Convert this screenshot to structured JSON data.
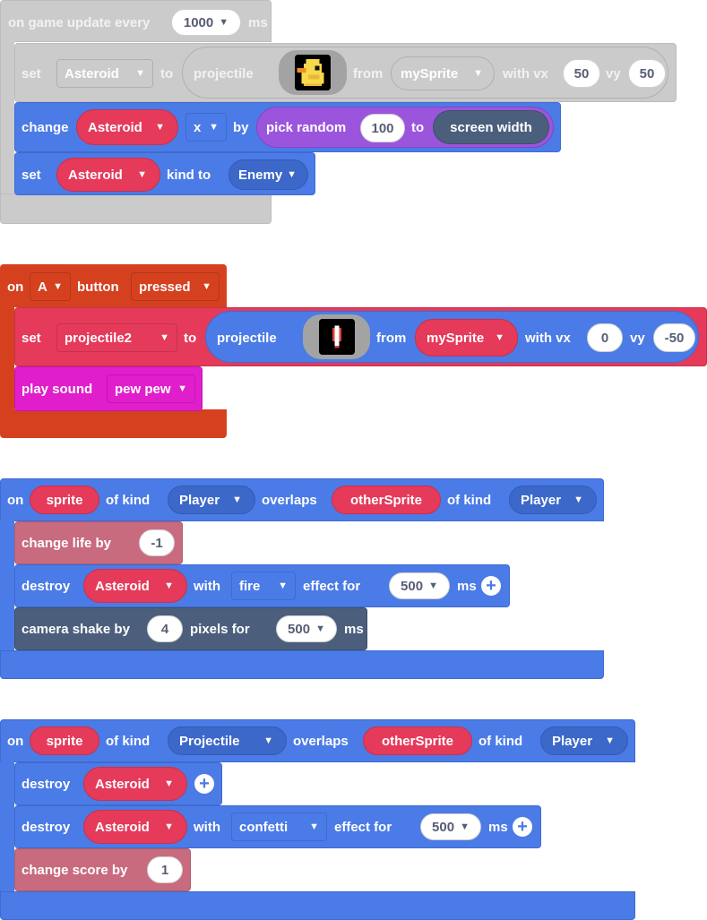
{
  "event_update": {
    "header": {
      "prefix": "on game update every",
      "interval": "1000",
      "suffix": "ms"
    },
    "set_row": {
      "set": "set",
      "variable": "Asteroid",
      "to": "to",
      "projectile": "projectile",
      "from": "from",
      "source": "mySprite",
      "with_vx": "with vx",
      "vx": "50",
      "vy_label": "vy",
      "vy": "50"
    },
    "change_row": {
      "change": "change",
      "variable": "Asteroid",
      "prop": "x",
      "by": "by",
      "pick_random": "pick random",
      "min": "100",
      "to": "to",
      "max": "screen width"
    },
    "kind_row": {
      "set": "set",
      "variable": "Asteroid",
      "kind_to": "kind to",
      "kind": "Enemy"
    }
  },
  "event_button": {
    "header": {
      "on": "on",
      "button": "A",
      "button_label": "button",
      "action": "pressed"
    },
    "set_row": {
      "set": "set",
      "variable": "projectile2",
      "to": "to",
      "projectile": "projectile",
      "from": "from",
      "source": "mySprite",
      "with_vx": "with vx",
      "vx": "0",
      "vy_label": "vy",
      "vy": "-50"
    },
    "sound_row": {
      "play": "play sound",
      "sound": "pew pew"
    }
  },
  "event_overlap1": {
    "header": {
      "on": "on",
      "sprite": "sprite",
      "of_kind": "of kind",
      "kind1": "Player",
      "overlaps": "overlaps",
      "other": "otherSprite",
      "of_kind2": "of kind",
      "kind2": "Player"
    },
    "life_row": {
      "label": "change life by",
      "value": "-1"
    },
    "destroy_row": {
      "destroy": "destroy",
      "variable": "Asteroid",
      "with": "with",
      "effect": "fire",
      "effect_for": "effect for",
      "duration": "500",
      "ms": "ms"
    },
    "shake_row": {
      "label": "camera shake by",
      "pixels": "4",
      "pixels_for": "pixels for",
      "duration": "500",
      "ms": "ms"
    }
  },
  "event_overlap2": {
    "header": {
      "on": "on",
      "sprite": "sprite",
      "of_kind": "of kind",
      "kind1": "Projectile",
      "overlaps": "overlaps",
      "other": "otherSprite",
      "of_kind2": "of kind",
      "kind2": "Player"
    },
    "destroy_row1": {
      "destroy": "destroy",
      "variable": "Asteroid"
    },
    "destroy_row2": {
      "destroy": "destroy",
      "variable": "Asteroid",
      "with": "with",
      "effect": "confetti",
      "effect_for": "effect for",
      "duration": "500",
      "ms": "ms"
    },
    "score_row": {
      "label": "change score by",
      "value": "1"
    }
  },
  "colors": {
    "disabled_block": "#cbcbcb",
    "sprites_blue": "#4b7be6",
    "variable_red": "#e53a5a",
    "math_purple": "#9b55dd",
    "scene_slate": "#4b5f7d",
    "controller_orange": "#d5411f",
    "music_magenta": "#e01ecb",
    "info_pink": "#c86b7f"
  }
}
